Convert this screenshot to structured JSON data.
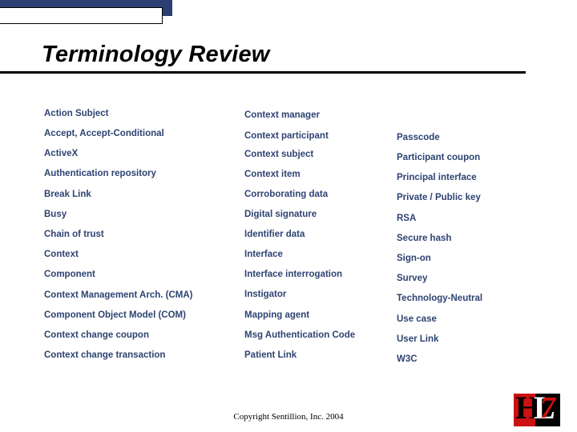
{
  "slide": {
    "title": "Terminology Review",
    "copyright": "Copyright Sentillion, Inc. 2004",
    "accent_blue": "#2c3f72",
    "term_color": "#2e4372",
    "logo": {
      "name": "HL7",
      "letter_h": "H",
      "letter_l": "L",
      "digit_7": "7",
      "red": "#cc1111",
      "black": "#000000",
      "white": "#ffffff"
    }
  },
  "columns": {
    "left": [
      "Action Subject",
      "Accept, Accept-Conditional",
      "ActiveX",
      "Authentication repository",
      "Break Link",
      "Busy",
      "Chain of trust",
      "Context",
      "Component",
      "Context Management Arch. (CMA)",
      "Component Object Model (COM)",
      "Context change coupon",
      "Context change transaction"
    ],
    "middle": [
      "Context manager",
      "Context participant",
      "Context subject",
      "Context item",
      "Corroborating data",
      "Digital signature",
      "Identifier data",
      "Interface",
      "Interface interrogation",
      "Instigator",
      "Mapping agent",
      "Msg Authentication Code",
      "Patient Link"
    ],
    "right": [
      "Passcode",
      "Participant coupon",
      "Principal interface",
      "Private / Public key",
      "RSA",
      "Secure hash",
      "Sign-on",
      "Survey",
      "Technology-Neutral",
      "Use case",
      "User Link",
      "W3C"
    ]
  }
}
